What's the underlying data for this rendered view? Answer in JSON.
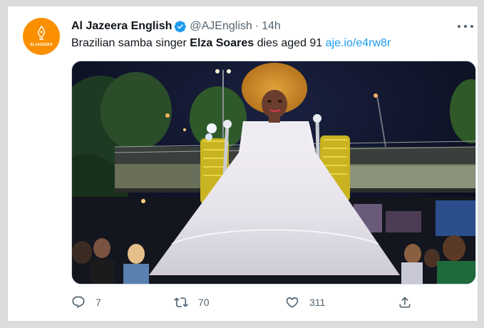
{
  "tweet": {
    "display_name": "Al Jazeera English",
    "handle": "@AJEnglish",
    "separator": "·",
    "time": "14h",
    "text_before": "Brazilian samba singer ",
    "text_bold": "Elza Soares",
    "text_after": " dies aged 91 ",
    "link": "aje.io/e4rw8r",
    "avatar_logo_text": "ALJAZEERA"
  },
  "actions": {
    "reply_count": "7",
    "retweet_count": "70",
    "like_count": "311"
  },
  "icons": {
    "verified": "verified-badge-icon",
    "more": "more-dots-icon",
    "reply": "reply-icon",
    "retweet": "retweet-icon",
    "like": "heart-icon",
    "share": "share-icon"
  },
  "colors": {
    "brand_orange": "#fa9000",
    "link_blue": "#1d9bf0",
    "verified_blue": "#1d9bf0",
    "text_primary": "#0f1419",
    "text_secondary": "#536471"
  }
}
